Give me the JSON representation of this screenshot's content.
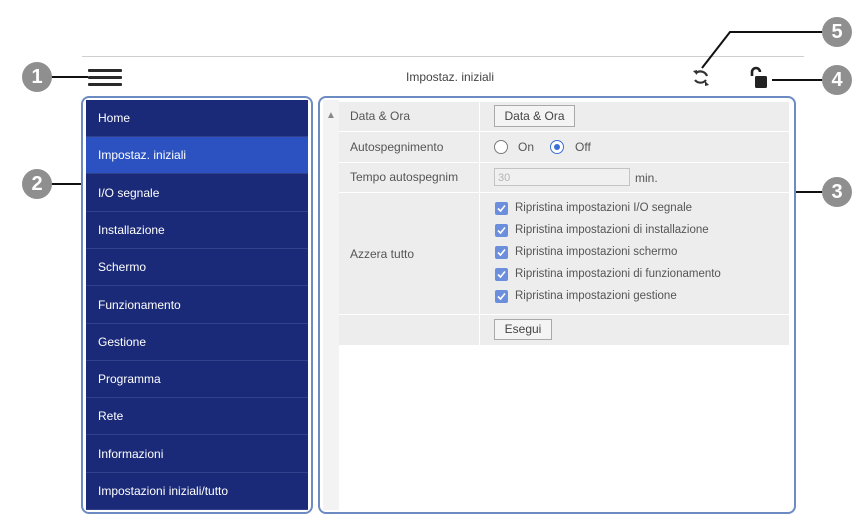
{
  "header": {
    "title": "Impostaz. iniziali",
    "menu_icon": "hamburger-menu-icon",
    "refresh_icon": "refresh-icon",
    "lock_icon": "unlock-icon"
  },
  "callouts": [
    "1",
    "2",
    "3",
    "4",
    "5"
  ],
  "sidebar": {
    "items": [
      {
        "label": "Home"
      },
      {
        "label": "Impostaz. iniziali"
      },
      {
        "label": "I/O segnale"
      },
      {
        "label": "Installazione"
      },
      {
        "label": "Schermo"
      },
      {
        "label": "Funzionamento"
      },
      {
        "label": "Gestione"
      },
      {
        "label": "Programma"
      },
      {
        "label": "Rete"
      },
      {
        "label": "Informazioni"
      },
      {
        "label": "Impostazioni iniziali/tutto"
      }
    ],
    "active_index": 1
  },
  "settings": {
    "date_time": {
      "label": "Data & Ora",
      "button": "Data & Ora"
    },
    "auto_off": {
      "label": "Autospegnimento",
      "on": "On",
      "off": "Off",
      "selected": "Off"
    },
    "auto_off_time": {
      "label": "Tempo autospegnim",
      "value": "30",
      "unit": "min."
    },
    "reset_all": {
      "label": "Azzera tutto",
      "options": [
        {
          "label": "Ripristina impostazioni I/O segnale",
          "checked": true
        },
        {
          "label": "Ripristina impostazioni di installazione",
          "checked": true
        },
        {
          "label": "Ripristina impostazioni schermo",
          "checked": true
        },
        {
          "label": "Ripristina impostazioni di funzionamento",
          "checked": true
        },
        {
          "label": "Ripristina impostazioni gestione",
          "checked": true
        }
      ],
      "execute_button": "Esegui"
    }
  },
  "colors": {
    "sidebar_bg": "#1a2a78",
    "sidebar_active": "#2b52c0",
    "frame_outline": "#6d8bc3",
    "checkbox": "#6b8fdd",
    "callout": "#8f8f8f"
  }
}
